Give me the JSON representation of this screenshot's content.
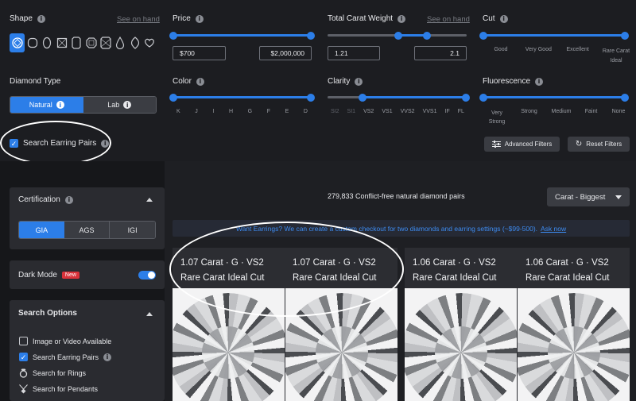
{
  "filters": {
    "shape": {
      "label": "Shape",
      "see_on_hand": "See on hand",
      "icons": [
        "round-shape-icon",
        "cushion-shape-icon",
        "oval-shape-icon",
        "princess-shape-icon",
        "emerald-shape-icon",
        "asscher-shape-icon",
        "radiant-shape-icon",
        "pear-shape-icon",
        "marquise-shape-icon",
        "heart-shape-icon"
      ]
    },
    "price": {
      "label": "Price",
      "min": "$700",
      "max": "$2,000,000"
    },
    "carat": {
      "label": "Total Carat Weight",
      "see_on_hand": "See on hand",
      "min": "1.21",
      "max": "2.1"
    },
    "cut": {
      "label": "Cut",
      "ticks": [
        "Good",
        "Very Good",
        "Excellent",
        "Rare Carat Ideal"
      ]
    },
    "diamond_type": {
      "label": "Diamond Type",
      "options": [
        "Natural",
        "Lab"
      ],
      "selected": "Natural"
    },
    "color": {
      "label": "Color",
      "ticks": [
        "K",
        "J",
        "I",
        "H",
        "G",
        "F",
        "E",
        "D"
      ]
    },
    "clarity": {
      "label": "Clarity",
      "ticks": [
        "SI2",
        "SI1",
        "VS2",
        "VS1",
        "VVS2",
        "VVS1",
        "IF",
        "FL"
      ]
    },
    "fluorescence": {
      "label": "Fluorescence",
      "ticks": [
        "Very Strong",
        "Strong",
        "Medium",
        "Faint",
        "None"
      ]
    },
    "earring_pairs": {
      "label": "Search Earring Pairs",
      "checked": true
    },
    "advanced_filters": "Advanced Filters",
    "reset_filters": "Reset Filters"
  },
  "sidebar": {
    "certification": {
      "title": "Certification",
      "options": [
        "GIA",
        "AGS",
        "IGI"
      ],
      "selected": "GIA"
    },
    "dark_mode": {
      "label": "Dark Mode",
      "badge": "New",
      "on": true
    },
    "search_options": {
      "title": "Search Options",
      "items": [
        {
          "label": "Image or Video Available",
          "kind": "checkbox",
          "checked": false
        },
        {
          "label": "Search Earring Pairs",
          "kind": "checkbox",
          "checked": true
        },
        {
          "label": "Search for Rings",
          "kind": "ring-icon"
        },
        {
          "label": "Search for Pendants",
          "kind": "pendant-icon"
        }
      ]
    }
  },
  "results": {
    "count_text": "279,833 Conflict-free natural diamond pairs",
    "sort": "Carat - Biggest",
    "banner_text": "Want Earrings? We can create a custom checkout for two diamonds and earring settings (~$99-500).",
    "banner_link": "Ask now",
    "pairs": [
      {
        "left": {
          "line1": "1.07 Carat · G · VS2",
          "line2": "Rare Carat Ideal Cut"
        },
        "right": {
          "line1": "1.07 Carat · G · VS2",
          "line2": "Rare Carat Ideal Cut"
        }
      },
      {
        "left": {
          "line1": "1.06 Carat · G · VS2",
          "line2": "Rare Carat Ideal Cut"
        },
        "right": {
          "line1": "1.06 Carat · G · VS2",
          "line2": "Rare Carat Ideal Cut"
        }
      }
    ]
  }
}
